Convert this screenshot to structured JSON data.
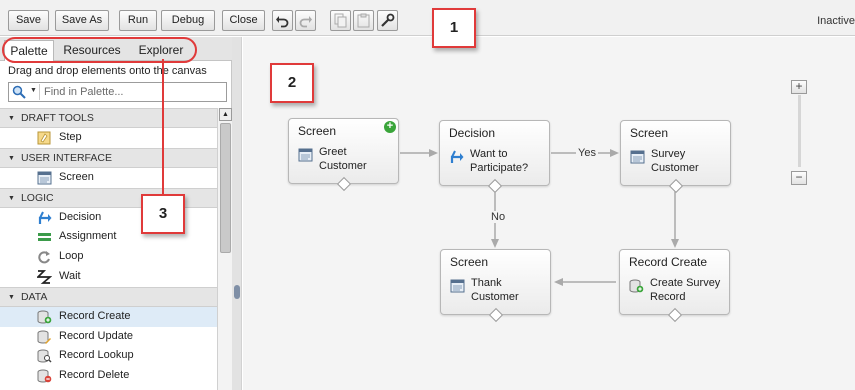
{
  "toolbar": {
    "save": "Save",
    "save_as": "Save As",
    "run": "Run",
    "debug": "Debug",
    "close": "Close",
    "status": "Inactive"
  },
  "callouts": {
    "one": "1",
    "two": "2",
    "three": "3"
  },
  "left_panel": {
    "tabs": {
      "palette": "Palette",
      "resources": "Resources",
      "explorer": "Explorer"
    },
    "hint": "Drag and drop elements onto the canvas",
    "search_placeholder": "Find in Palette...",
    "sections": [
      {
        "label": "DRAFT TOOLS",
        "items": [
          {
            "label": "Step",
            "icon": "step-icon"
          }
        ]
      },
      {
        "label": "USER INTERFACE",
        "items": [
          {
            "label": "Screen",
            "icon": "screen-icon"
          }
        ]
      },
      {
        "label": "LOGIC",
        "items": [
          {
            "label": "Decision",
            "icon": "decision-icon"
          },
          {
            "label": "Assignment",
            "icon": "assignment-icon"
          },
          {
            "label": "Loop",
            "icon": "loop-icon"
          },
          {
            "label": "Wait",
            "icon": "wait-icon"
          }
        ]
      },
      {
        "label": "DATA",
        "items": [
          {
            "label": "Record Create",
            "icon": "record-create-icon",
            "selected": true
          },
          {
            "label": "Record Update",
            "icon": "record-update-icon"
          },
          {
            "label": "Record Lookup",
            "icon": "record-lookup-icon"
          },
          {
            "label": "Record Delete",
            "icon": "record-delete-icon"
          }
        ]
      }
    ]
  },
  "canvas": {
    "nodes": {
      "greet": {
        "type": "Screen",
        "label": "Greet\nCustomer"
      },
      "decision": {
        "type": "Decision",
        "label": "Want to\nParticipate?"
      },
      "survey": {
        "type": "Screen",
        "label": "Survey\nCustomer"
      },
      "thank": {
        "type": "Screen",
        "label": "Thank\nCustomer"
      },
      "record": {
        "type": "Record Create",
        "label": "Create Survey\nRecord"
      }
    },
    "connectors": {
      "yes": "Yes",
      "no": "No"
    }
  },
  "colors": {
    "accent_red": "#e03a3a",
    "selection": "#deebf7",
    "decision_blue": "#2f7fd0",
    "start_green": "#3aa53a"
  }
}
